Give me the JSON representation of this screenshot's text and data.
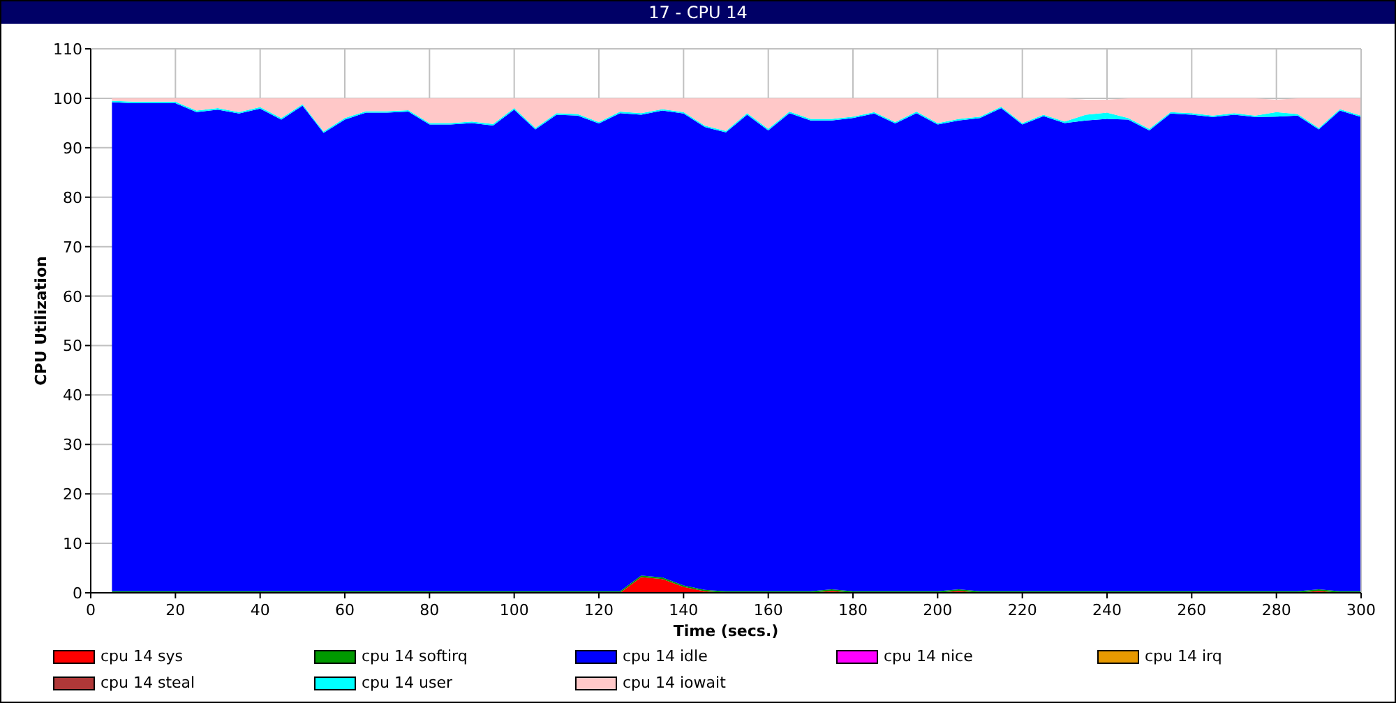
{
  "window": {
    "title": "17 - CPU 14"
  },
  "chart": {
    "chart_data": {
      "type": "area",
      "stacked": true,
      "grid": true,
      "xlabel": "Time (secs.)",
      "ylabel": "CPU Utilization",
      "x": [
        5,
        10,
        15,
        20,
        25,
        30,
        35,
        40,
        45,
        50,
        55,
        60,
        65,
        70,
        75,
        80,
        85,
        90,
        95,
        100,
        105,
        110,
        115,
        120,
        125,
        130,
        135,
        140,
        145,
        150,
        155,
        160,
        165,
        170,
        175,
        180,
        185,
        190,
        195,
        200,
        205,
        210,
        215,
        220,
        225,
        230,
        235,
        240,
        245,
        250,
        255,
        260,
        265,
        270,
        275,
        280,
        285,
        290,
        295,
        300
      ],
      "xlim": [
        0,
        300
      ],
      "ylim": [
        0,
        110
      ],
      "xticks": [
        0,
        20,
        40,
        60,
        80,
        100,
        120,
        140,
        160,
        180,
        200,
        220,
        240,
        260,
        280,
        300
      ],
      "yticks": [
        0,
        10,
        20,
        30,
        40,
        50,
        60,
        70,
        80,
        90,
        100,
        110
      ],
      "series": [
        {
          "name": "cpu 14 sys",
          "color": "#ff0000",
          "values": [
            0,
            0,
            0,
            0,
            0,
            0,
            0,
            0,
            0,
            0,
            0,
            0,
            0,
            0,
            0,
            0,
            0,
            0,
            0,
            0,
            0,
            0,
            0,
            0,
            0,
            3.2,
            2.8,
            1.2,
            0.3,
            0,
            0,
            0,
            0,
            0,
            0.4,
            0,
            0,
            0,
            0,
            0,
            0.4,
            0,
            0,
            0,
            0,
            0,
            0,
            0,
            0,
            0,
            0,
            0,
            0,
            0,
            0,
            0,
            0,
            0.4,
            0,
            0
          ]
        },
        {
          "name": "cpu 14 softirq",
          "color": "#009900",
          "values": [
            0.3,
            0.3,
            0.3,
            0.3,
            0.3,
            0.3,
            0.3,
            0.3,
            0.3,
            0.3,
            0.3,
            0.3,
            0.3,
            0.3,
            0.3,
            0.3,
            0.3,
            0.3,
            0.3,
            0.3,
            0.3,
            0.3,
            0.3,
            0.3,
            0.3,
            0.3,
            0.3,
            0.3,
            0.3,
            0.3,
            0.3,
            0.3,
            0.3,
            0.3,
            0.3,
            0.3,
            0.3,
            0.3,
            0.3,
            0.3,
            0.3,
            0.3,
            0.3,
            0.3,
            0.3,
            0.3,
            0.3,
            0.3,
            0.3,
            0.3,
            0.3,
            0.3,
            0.3,
            0.3,
            0.3,
            0.3,
            0.3,
            0.3,
            0.3,
            0.3
          ]
        },
        {
          "name": "cpu 14 idle",
          "color": "#0000ff",
          "values": [
            98.9,
            98.7,
            98.7,
            98.7,
            96.9,
            97.4,
            96.6,
            97.6,
            95.4,
            98.2,
            92.7,
            95.4,
            96.8,
            96.8,
            97,
            94.4,
            94.4,
            94.7,
            94.2,
            97.4,
            93.4,
            96.4,
            96.2,
            94.6,
            96.7,
            93.2,
            94.4,
            95.4,
            93.6,
            92.8,
            96.4,
            93.2,
            96.7,
            95.2,
            94.8,
            95.7,
            96.6,
            94.6,
            96.7,
            94.4,
            94.8,
            95.7,
            97.7,
            94.4,
            96.1,
            94.7,
            95.2,
            95.5,
            95.4,
            93.2,
            96.6,
            96.4,
            95.9,
            96.4,
            95.9,
            96,
            96.2,
            93,
            97.2,
            95.9
          ]
        },
        {
          "name": "cpu 14 nice",
          "color": "#ff00ff",
          "values": [
            null,
            null,
            null,
            null,
            null,
            null,
            null,
            null,
            null,
            null,
            null,
            null,
            null,
            null,
            null,
            null,
            null,
            null,
            null,
            null,
            null,
            null,
            null,
            null,
            null,
            null,
            null,
            null,
            null,
            null,
            null,
            null,
            null,
            null,
            null,
            null,
            null,
            null,
            null,
            null,
            null,
            null,
            null,
            null,
            null,
            null,
            null,
            null,
            null,
            null,
            null,
            null,
            null,
            null,
            null,
            null,
            null,
            null,
            null,
            null
          ]
        },
        {
          "name": "cpu 14 irq",
          "color": "#e69900",
          "values": [
            null,
            null,
            null,
            null,
            null,
            null,
            null,
            null,
            null,
            null,
            null,
            null,
            null,
            null,
            null,
            null,
            null,
            null,
            null,
            null,
            null,
            null,
            null,
            null,
            null,
            null,
            null,
            null,
            null,
            null,
            null,
            null,
            null,
            null,
            null,
            null,
            null,
            null,
            null,
            null,
            null,
            null,
            null,
            null,
            null,
            null,
            null,
            null,
            null,
            null,
            null,
            null,
            null,
            null,
            null,
            null,
            null,
            null,
            null,
            null
          ]
        },
        {
          "name": "cpu 14 steal",
          "color": "#b03838",
          "values": [
            null,
            null,
            null,
            null,
            null,
            null,
            null,
            null,
            null,
            null,
            null,
            null,
            null,
            null,
            null,
            null,
            null,
            null,
            null,
            null,
            null,
            null,
            null,
            null,
            null,
            null,
            null,
            null,
            null,
            null,
            null,
            null,
            null,
            null,
            null,
            null,
            null,
            null,
            null,
            null,
            null,
            null,
            null,
            null,
            null,
            null,
            null,
            null,
            null,
            null,
            null,
            null,
            null,
            null,
            null,
            null,
            null,
            null,
            null,
            null
          ]
        },
        {
          "name": "cpu 14 user",
          "color": "#00ffff",
          "values": [
            0.3,
            0.3,
            0.3,
            0.3,
            0.3,
            0.3,
            0.3,
            0.3,
            0.3,
            0.3,
            0.3,
            0.3,
            0.3,
            0.3,
            0.3,
            0.3,
            0.3,
            0.3,
            0.3,
            0.3,
            0.3,
            0.3,
            0.3,
            0.3,
            0.3,
            0.3,
            0.3,
            0.3,
            0.3,
            0.3,
            0.3,
            0.3,
            0.3,
            0.3,
            0.3,
            0.3,
            0.3,
            0.3,
            0.3,
            0.3,
            0.3,
            0.3,
            0.3,
            0.3,
            0.3,
            0.3,
            1.2,
            1.3,
            0.3,
            0.3,
            0.3,
            0.3,
            0.3,
            0.3,
            0.3,
            0.9,
            0.3,
            0.3,
            0.3,
            0.3
          ]
        },
        {
          "name": "cpu 14 iowait",
          "color": "#ffc8c8",
          "values": [
            0.5,
            0.7,
            0.7,
            0.7,
            2.5,
            2,
            2.8,
            1.8,
            4,
            1.2,
            6.7,
            4,
            2.6,
            2.6,
            2.4,
            5,
            5,
            4.7,
            5.2,
            2,
            6,
            3,
            3.2,
            4.8,
            2.7,
            3,
            2.2,
            2.8,
            5.5,
            6.6,
            3,
            6.2,
            2.7,
            4.2,
            4.2,
            3.7,
            2.8,
            4.8,
            2.7,
            5,
            4.2,
            3.7,
            1.7,
            5,
            3.3,
            4.7,
            3,
            2.6,
            4,
            6.2,
            2.8,
            3,
            3.5,
            3,
            3.5,
            2.5,
            3.2,
            6,
            2.2,
            3.5
          ]
        }
      ]
    }
  }
}
